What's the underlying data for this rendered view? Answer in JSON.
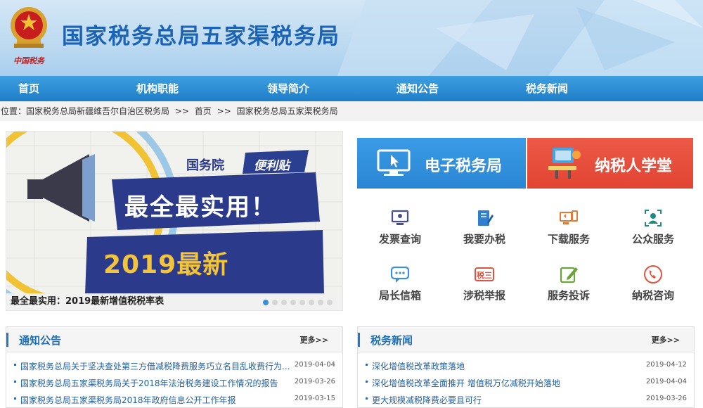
{
  "header": {
    "site_title": "国家税务总局五家渠税务局",
    "logo_caption": "中国税务"
  },
  "nav": {
    "items": [
      "首页",
      "机构职能",
      "领导简介",
      "通知公告",
      "税务新闻"
    ]
  },
  "breadcrumb": {
    "prefix": "位置：",
    "parts": [
      "国家税务总局新疆维吾尔自治区税务局",
      ">>",
      "首页",
      ">>",
      "国家税务总局五家渠税务局"
    ]
  },
  "slider": {
    "tag1": "国务院",
    "tag2": "便利贴",
    "headline": "最全最实用！",
    "subline": "2019最新",
    "subline2": "增值税税率表",
    "caption": "最全最实用：2019最新增值税税率表",
    "dot_count": 8,
    "active_dot": 1
  },
  "big_buttons": {
    "e_tax": "电子税务局",
    "school": "纳税人学堂"
  },
  "services": [
    {
      "label": "发票查询",
      "icon": "monitor-icon"
    },
    {
      "label": "我要办税",
      "icon": "notebook-pen-icon"
    },
    {
      "label": "下载服务",
      "icon": "download-devices-icon"
    },
    {
      "label": "公众服务",
      "icon": "public-user-icon"
    },
    {
      "label": "局长信箱",
      "icon": "chat-bubble-icon"
    },
    {
      "label": "涉税举报",
      "icon": "tax-report-icon"
    },
    {
      "label": "服务投诉",
      "icon": "edit-note-icon"
    },
    {
      "label": "纳税咨询",
      "icon": "phone-icon"
    }
  ],
  "notice": {
    "title": "通知公告",
    "more": "更多>>",
    "items": [
      {
        "text": "国家税务总局关于坚决查处第三方借减税降费服务巧立名目乱收费行为...",
        "date": "2019-04-04"
      },
      {
        "text": "国家税务总局五家渠税务局关于2018年法治税务建设工作情况的报告",
        "date": "2019-03-26"
      },
      {
        "text": "国家税务总局五家渠税务局2018年政府信息公开工作年报",
        "date": "2019-03-15"
      }
    ]
  },
  "news": {
    "title": "税务新闻",
    "more": "更多>>",
    "items": [
      {
        "text": "深化增值税改革政策落地",
        "date": "2019-04-12"
      },
      {
        "text": "深化增值税改革全面推开 增值税万亿减税开始落地",
        "date": "2019-04-04"
      },
      {
        "text": "更大规模减税降费必要且可行",
        "date": "2019-03-26"
      }
    ]
  },
  "colors": {
    "nav_blue": "#2a8ad4",
    "e_tax_blue": "#2d8fe0",
    "school_red": "#e84c3d",
    "title_blue": "#1b63b5"
  }
}
